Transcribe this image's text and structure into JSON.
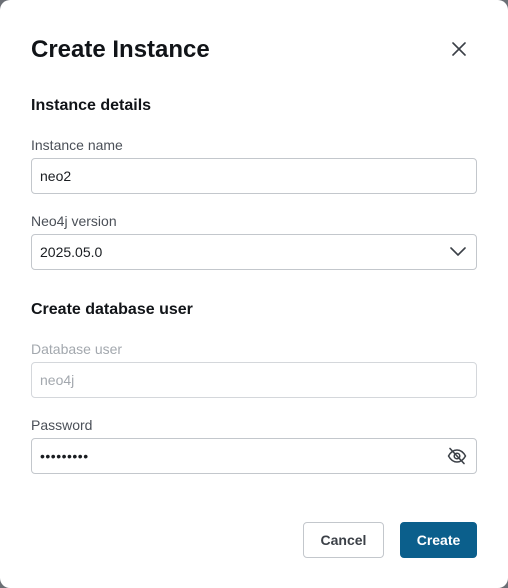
{
  "dialog": {
    "title": "Create Instance",
    "close_icon": "close-icon"
  },
  "instance_details": {
    "heading": "Instance details",
    "name_label": "Instance name",
    "name_value": "neo2",
    "version_label": "Neo4j version",
    "version_value": "2025.05.0",
    "version_icon": "chevron-down-icon"
  },
  "database_user": {
    "heading": "Create database user",
    "user_label": "Database user",
    "user_value": "neo4j",
    "password_label": "Password",
    "password_masked": "•••••••••",
    "visibility_icon": "eye-off-icon"
  },
  "actions": {
    "cancel_label": "Cancel",
    "create_label": "Create"
  },
  "colors": {
    "primary": "#0b5f8c",
    "border": "#c3c7cc",
    "disabled_text": "#a3a8ae"
  }
}
